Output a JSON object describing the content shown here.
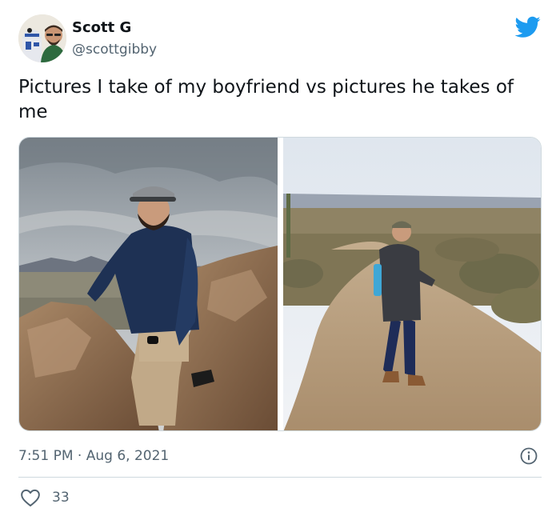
{
  "author": {
    "display_name": "Scott G",
    "handle": "@scottgibby",
    "avatar_icon": "avatar-photo"
  },
  "brand": {
    "icon": "twitter-bird-icon",
    "color": "#1d9bf0"
  },
  "tweet": {
    "text": "Pictures I take of my boyfriend vs pictures he takes of me",
    "time": "7:51 PM",
    "separator": "·",
    "date": "Aug 6, 2021",
    "info_icon": "info-icon"
  },
  "media": {
    "photos": [
      {
        "name": "boyfriend-on-rocks-photo"
      },
      {
        "name": "me-on-trail-photo"
      }
    ]
  },
  "engagement": {
    "like_icon": "heart-icon",
    "likes": "33"
  },
  "colors": {
    "text_primary": "#0f1419",
    "text_secondary": "#536471",
    "border": "#cfd9de",
    "brand_blue": "#1d9bf0"
  }
}
